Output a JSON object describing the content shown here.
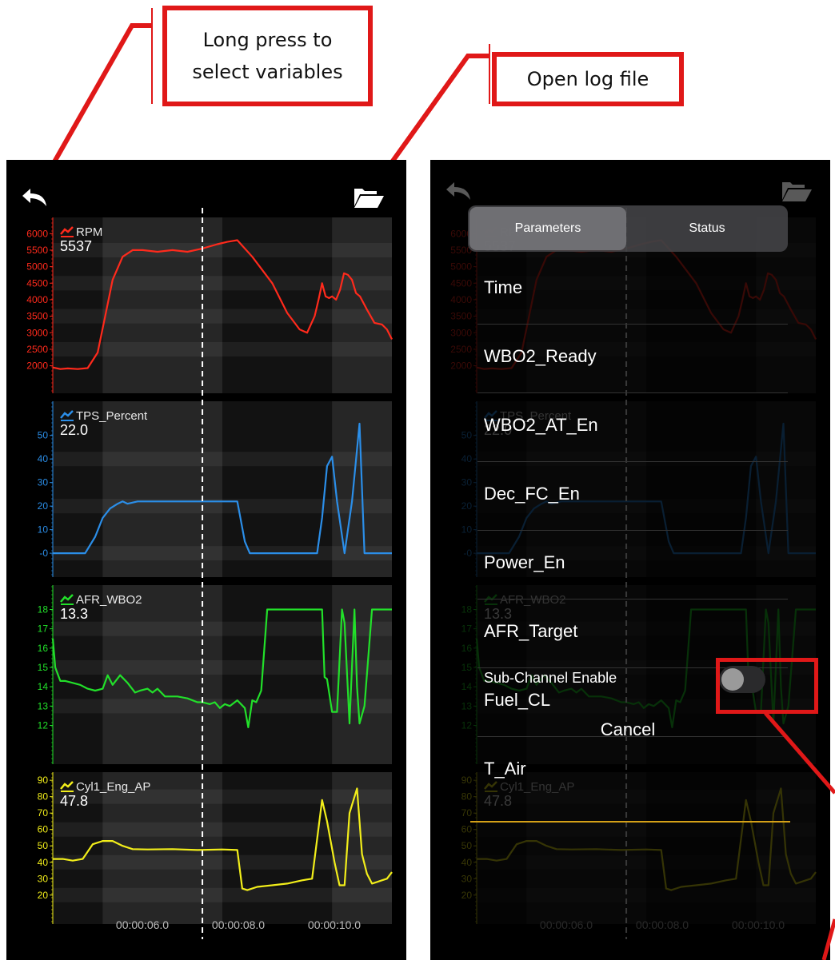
{
  "callouts": {
    "long_press": "Long press to select variables",
    "long_press_line1": "Long press to",
    "long_press_line2": "select variables",
    "open_log": "Open log file"
  },
  "colors": {
    "rpm": "#ff2a1c",
    "tps": "#2b8ee8",
    "afr": "#22e02a",
    "cyl": "#f2ee1a",
    "callout_border": "#e01818",
    "cursor_line": "#ffffff",
    "marker_line": "#d4a017"
  },
  "icons": {
    "back": "back-arrow-icon",
    "open": "folder-open-icon",
    "series": "line-chart-icon"
  },
  "chart_data": [
    {
      "type": "line",
      "name": "RPM",
      "current_value": "5537",
      "yticks": [
        "6000",
        "5500",
        "5000",
        "4500",
        "4000",
        "3500",
        "3000",
        "2500",
        "2000"
      ],
      "ylim": [
        1700,
        6200
      ],
      "xticks": [
        "00:00:06.0",
        "00:00:08.0",
        "00:00:10.0"
      ],
      "xlim": [
        4.6,
        11.4
      ],
      "cursor_x": 7.6,
      "series": [
        {
          "name": "RPM",
          "x": [
            4.6,
            4.75,
            4.9,
            5.1,
            5.3,
            5.5,
            5.65,
            5.8,
            6.0,
            6.2,
            6.4,
            6.7,
            7.0,
            7.3,
            7.6,
            7.9,
            8.1,
            8.3,
            8.6,
            9.0,
            9.3,
            9.55,
            9.7,
            9.85,
            9.93,
            10.0,
            10.07,
            10.14,
            10.2,
            10.28,
            10.36,
            10.44,
            10.52,
            10.6,
            10.68,
            10.76,
            10.9,
            11.05,
            11.2,
            11.3,
            11.4
          ],
          "values": [
            1950,
            1900,
            1920,
            1900,
            1930,
            2400,
            3500,
            4600,
            5300,
            5500,
            5500,
            5450,
            5500,
            5450,
            5550,
            5680,
            5750,
            5800,
            5300,
            4500,
            3600,
            3100,
            3000,
            3500,
            4000,
            4500,
            4100,
            4050,
            4100,
            4000,
            4300,
            4800,
            4750,
            4600,
            4200,
            4100,
            3700,
            3300,
            3250,
            3100,
            2800
          ]
        }
      ]
    },
    {
      "type": "line",
      "name": "TPS_Percent",
      "current_value": "22.0",
      "yticks": [
        "50",
        "40",
        "30",
        "20",
        "10",
        "-0"
      ],
      "ylim": [
        -2,
        55
      ],
      "xlim": [
        4.6,
        11.4
      ],
      "cursor_x": 7.6,
      "series": [
        {
          "name": "TPS_Percent",
          "x": [
            4.6,
            5.0,
            5.25,
            5.45,
            5.6,
            5.75,
            5.9,
            6.0,
            6.1,
            6.3,
            7.0,
            7.6,
            8.0,
            8.3,
            8.45,
            8.55,
            9.9,
            10.0,
            10.1,
            10.2,
            10.3,
            10.45,
            10.6,
            10.75,
            10.85,
            11.0,
            11.4
          ],
          "values": [
            0,
            0,
            0,
            7,
            15,
            19,
            21,
            22,
            21,
            22,
            22,
            22,
            22,
            22,
            5,
            0,
            0,
            15,
            37,
            41,
            22,
            0,
            22,
            55,
            0,
            0,
            0
          ]
        }
      ]
    },
    {
      "type": "line",
      "name": "AFR_WBO2",
      "current_value": "13.3",
      "yticks": [
        "18",
        "17",
        "16",
        "15",
        "14",
        "13",
        "12"
      ],
      "ylim": [
        11.4,
        18.6
      ],
      "xlim": [
        4.6,
        11.4
      ],
      "cursor_x": 7.6,
      "series": [
        {
          "name": "AFR_WBO2",
          "x": [
            4.6,
            4.65,
            4.75,
            4.85,
            5.0,
            5.15,
            5.3,
            5.45,
            5.6,
            5.7,
            5.8,
            5.95,
            6.1,
            6.25,
            6.35,
            6.5,
            6.6,
            6.7,
            6.85,
            6.95,
            7.1,
            7.3,
            7.5,
            7.6,
            7.75,
            7.85,
            7.95,
            8.05,
            8.15,
            8.3,
            8.45,
            8.52,
            8.6,
            8.68,
            8.78,
            8.9,
            9.2,
            9.8,
            10.0,
            10.05,
            10.1,
            10.2,
            10.3,
            10.4,
            10.45,
            10.55,
            10.65,
            10.7,
            10.75,
            10.85,
            11.0,
            11.4
          ],
          "values": [
            16.5,
            15,
            14.3,
            14.3,
            14.2,
            14.1,
            13.9,
            13.8,
            13.9,
            14.6,
            14.1,
            14.6,
            14.2,
            13.7,
            13.8,
            13.9,
            13.7,
            13.9,
            13.5,
            13.5,
            13.5,
            13.4,
            13.2,
            13.2,
            13.1,
            13.2,
            12.9,
            13.1,
            13,
            13.3,
            12.9,
            11.9,
            13.3,
            13.2,
            13.8,
            18,
            18,
            18,
            18,
            14.5,
            14.4,
            12.7,
            12.7,
            18,
            17.3,
            12.1,
            18,
            14,
            12.1,
            13,
            18,
            18
          ]
        }
      ]
    },
    {
      "type": "line",
      "name": "Cyl1_Eng_AP",
      "current_value": "47.8",
      "yticks": [
        "90",
        "80",
        "70",
        "60",
        "50",
        "40",
        "30",
        "20"
      ],
      "ylim": [
        16,
        93
      ],
      "xticks": [
        "00:00:06.0",
        "00:00:08.0",
        "00:00:10.0"
      ],
      "xlim": [
        4.6,
        11.4
      ],
      "cursor_x": 7.6,
      "series": [
        {
          "name": "Cyl1_Eng_AP",
          "x": [
            4.6,
            4.8,
            5.0,
            5.2,
            5.4,
            5.6,
            5.8,
            6.0,
            6.2,
            6.5,
            7.0,
            7.5,
            8.0,
            8.3,
            8.4,
            8.5,
            8.7,
            9.0,
            9.3,
            9.6,
            9.8,
            10.0,
            10.1,
            10.25,
            10.35,
            10.45,
            10.55,
            10.7,
            10.8,
            10.9,
            11.0,
            11.1,
            11.2,
            11.3,
            11.4
          ],
          "values": [
            42,
            42,
            41,
            42,
            51,
            53,
            53,
            50,
            48,
            47.8,
            48,
            47.5,
            47.8,
            47.5,
            24,
            23,
            25,
            26,
            27,
            29,
            30,
            78,
            65,
            40,
            26,
            26,
            70,
            85,
            45,
            33,
            27,
            28,
            29,
            30,
            34
          ]
        }
      ]
    }
  ],
  "modal": {
    "tabs": [
      "Parameters",
      "Status"
    ],
    "active_tab": "Parameters",
    "items": [
      "Time",
      "WBO2_Ready",
      "WBO2_AT_En",
      "Dec_FC_En",
      "Power_En",
      "AFR_Target",
      "Fuel_CL",
      "T_Air"
    ],
    "sub_channel_label": "Sub-Channel Enable",
    "sub_channel_enabled": false,
    "cancel_label": "Cancel"
  }
}
